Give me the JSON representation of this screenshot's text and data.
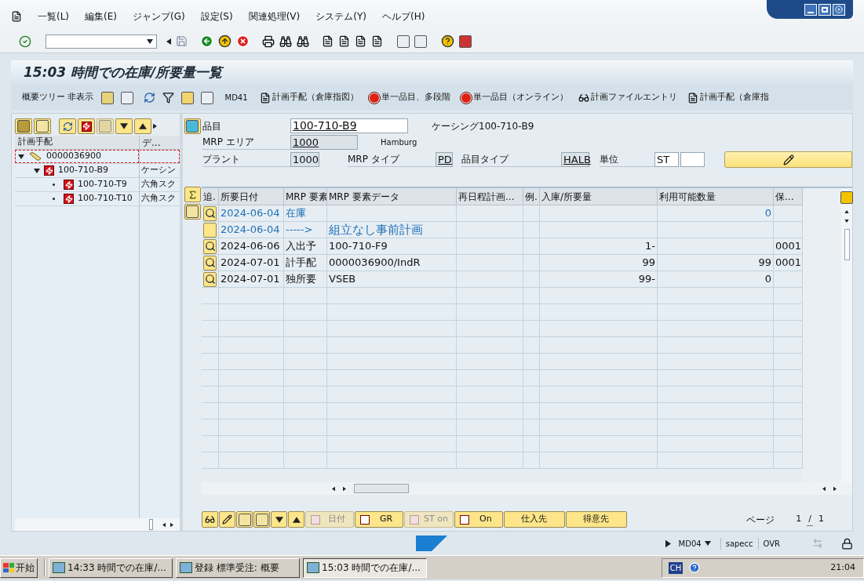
{
  "menu": [
    {
      "label": "一覧(L)"
    },
    {
      "label": "編集(E)"
    },
    {
      "label": "ジャンプ(G)"
    },
    {
      "label": "設定(S)"
    },
    {
      "label": "関連処理(V)"
    },
    {
      "label": "システム(Y)"
    },
    {
      "label": "ヘルプ(H)"
    }
  ],
  "screen_title": "15:03 時間での在庫/所要量一覧",
  "app_toolbar": [
    "概要ツリー 非表示",
    "MD41",
    "計画手配（倉庫指図）",
    "単一品目、多段階",
    "単一品目（オンライン）",
    "計画ファイルエントリ",
    "計画手配（倉庫指"
  ],
  "tree": {
    "columns": [
      "計画手配",
      "デ..."
    ],
    "nodes": [
      {
        "label": "0000036900",
        "expanded": true,
        "selected": true,
        "children": [
          {
            "label": "100-710-B9",
            "description": "ケーシン",
            "expanded": true,
            "selected": false,
            "children": [
              {
                "label": "100-710-T9",
                "description": "六角スク",
                "selected": false
              },
              {
                "label": "100-710-T10",
                "description": "六角スク",
                "selected": false
              }
            ]
          }
        ]
      }
    ]
  },
  "header": {
    "material": {
      "label": "品目",
      "value": "100-710-B9",
      "description": "ケーシング100-710-B9"
    },
    "mrp_area": {
      "label": "MRP エリア",
      "value": "1000",
      "description": "Hamburg"
    },
    "plant": {
      "label": "プラント",
      "value": "1000"
    },
    "mrp_type": {
      "label": "MRP タイプ",
      "value": "PD"
    },
    "material_type": {
      "label": "品目タイプ",
      "value": "HALB"
    },
    "unit": {
      "label": "単位",
      "value": "ST"
    }
  },
  "table": {
    "columns": [
      "追.",
      "所要日付",
      "MRP 要素",
      "MRP 要素データ",
      "再日程計画...",
      "例.",
      "入庫/所要量",
      "利用可能数量",
      "保..."
    ],
    "rows": [
      {
        "kind": "stock",
        "date": "2024-06-04",
        "element": "在庫",
        "data": "",
        "quantity": "",
        "available": "0",
        "storage": ""
      },
      {
        "kind": "heading",
        "date": "2024-06-04",
        "element": "----->",
        "data": "組立なし事前計画",
        "quantity": "",
        "available": "",
        "storage": ""
      },
      {
        "kind": "element",
        "date": "2024-06-06",
        "element": "入出予",
        "data": "100-710-F9",
        "quantity": "1-",
        "available": "",
        "storage": "0001"
      },
      {
        "kind": "element",
        "date": "2024-07-01",
        "element": "計手配",
        "data": "0000036900/IndR",
        "quantity": "99",
        "available": "99",
        "storage": "0001"
      },
      {
        "kind": "element",
        "date": "2024-07-01",
        "element": "独所要",
        "data": "VSEB",
        "quantity": "99-",
        "available": "0",
        "storage": ""
      }
    ]
  },
  "bottom_buttons": [
    {
      "label": "日付",
      "disabled": true
    },
    {
      "label": "GR",
      "disabled": false
    },
    {
      "label": "ST on",
      "disabled": true
    },
    {
      "label": "On",
      "disabled": false
    },
    {
      "label": "仕入先",
      "disabled": false
    },
    {
      "label": "得意先",
      "disabled": false
    }
  ],
  "pager": {
    "label": "ページ",
    "current": "1",
    "separator": "/",
    "total": "1"
  },
  "status_bar": {
    "transaction": "MD04",
    "system": "sapecc",
    "mode": "OVR"
  },
  "taskbar": {
    "start": "开始",
    "tasks": [
      {
        "label": "14:33 時間での在庫/...",
        "selected": false
      },
      {
        "label": "登録 標準受注: 概要",
        "selected": false
      },
      {
        "label": "15:03 時間での在庫/...",
        "selected": true
      }
    ],
    "language": "CH",
    "clock": "21:04"
  }
}
